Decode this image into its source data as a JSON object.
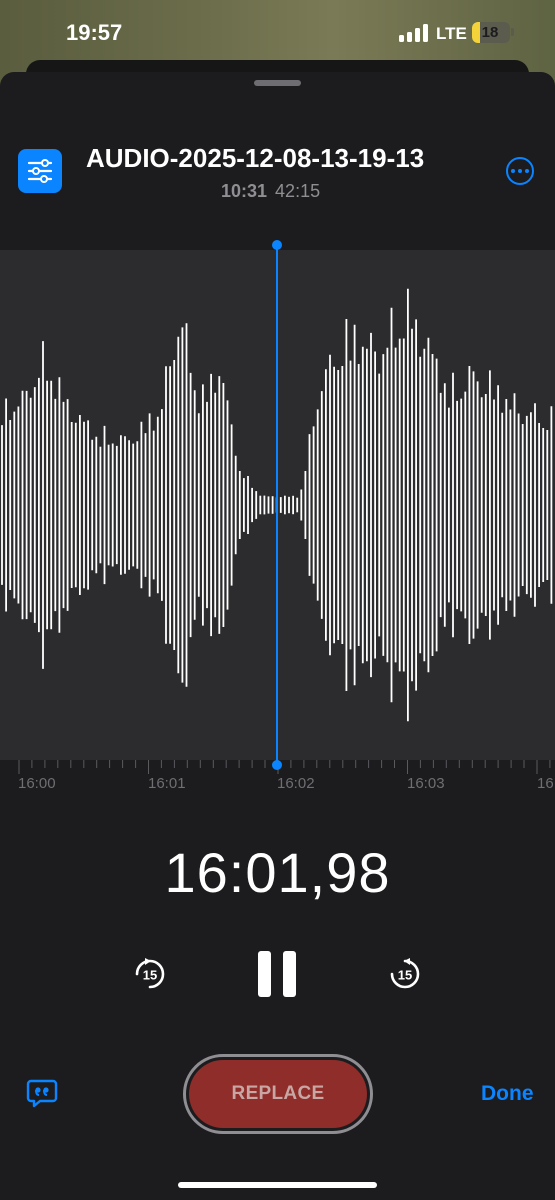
{
  "status_bar": {
    "time": "19:57",
    "network": "LTE",
    "battery_level": "18",
    "signal_bars": 4
  },
  "recording": {
    "title": "AUDIO-2025-12-08-13-19-13",
    "current_time": "10:31",
    "total_duration": "42:15",
    "elapsed": "16:01,98"
  },
  "timeline": {
    "labels": [
      "16:00",
      "16:01",
      "16:02",
      "16:03",
      "16"
    ]
  },
  "controls": {
    "skip_back_seconds": "15",
    "skip_forward_seconds": "15"
  },
  "bottom_bar": {
    "replace_label": "REPLACE",
    "done_label": "Done"
  },
  "icons": {
    "options": "sliders-icon",
    "more": "ellipsis-circle-icon",
    "skip_back": "gobackward-15-icon",
    "pause": "pause-icon",
    "skip_forward": "goforward-15-icon",
    "transcript": "quote-bubble-icon"
  },
  "colors": {
    "accent": "#0a84ff",
    "sheet_background": "#1c1c1e",
    "waveform_background": "#2c2c2e",
    "record_button": "#8e2d2a",
    "battery_fill": "#f4d23a"
  }
}
